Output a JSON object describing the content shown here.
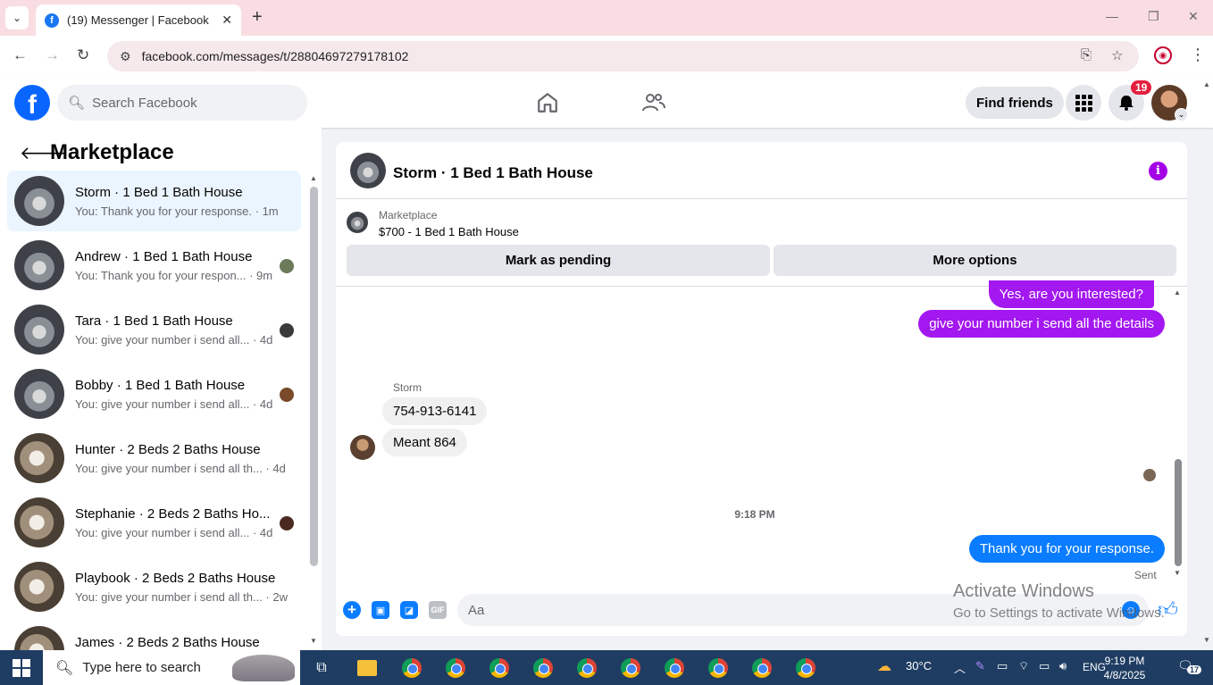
{
  "browser": {
    "tab_title": "(19) Messenger | Facebook",
    "url": "facebook.com/messages/t/28804697279178102"
  },
  "fb": {
    "search_placeholder": "Search Facebook",
    "find_friends": "Find friends",
    "notification_count": "19"
  },
  "sidebar": {
    "title": "Marketplace",
    "conversations": [
      {
        "name": "Storm · 1 Bed 1 Bath House",
        "snippet": "You: Thank you for your response. · 1m",
        "active": true
      },
      {
        "name": "Andrew · 1 Bed 1 Bath House",
        "snippet": "You: Thank you for your respon... · 9m"
      },
      {
        "name": "Tara · 1 Bed 1 Bath House",
        "snippet": "You: give your number i send all... · 4d"
      },
      {
        "name": "Bobby · 1 Bed 1 Bath House",
        "snippet": "You: give your number i send all... · 4d"
      },
      {
        "name": "Hunter · 2 Beds 2 Baths House",
        "snippet": "You: give your number i send all th... · 4d"
      },
      {
        "name": "Stephanie · 2 Beds 2 Baths Ho...",
        "snippet": "You: give your number i send all... · 4d"
      },
      {
        "name": "Playbook · 2 Beds 2 Baths House",
        "snippet": "You: give your number i send all th... · 2w"
      },
      {
        "name": "James · 2 Beds 2 Baths House",
        "snippet": ""
      }
    ]
  },
  "chat": {
    "title": "Storm · 1 Bed 1 Bath House",
    "listing_source": "Marketplace",
    "listing_price": "$700 - 1 Bed 1 Bath House",
    "mark_pending": "Mark as pending",
    "more_options": "More options",
    "messages": {
      "m1": "Yes, are you interested?",
      "m2": "give your number i send  all the details",
      "sender": "Storm",
      "m3": "754-913-6141",
      "m4": "Meant 864",
      "timestamp": "9:18 PM",
      "m5": "Thank you for your response.",
      "status": "Sent"
    },
    "composer_placeholder": "Aa",
    "gif_label": "GIF"
  },
  "watermark": {
    "line1": "Activate Windows",
    "line2": "Go to Settings to activate Windows."
  },
  "taskbar": {
    "search_placeholder": "Type here to search",
    "weather": "30°C",
    "language": "ENG",
    "time": "9:19 PM",
    "date": "4/8/2025",
    "notifications": "17"
  },
  "colors": {
    "fb_blue": "#0866ff",
    "sent_bubble": "#0a7cff",
    "purple_bubble": "#a317f0",
    "active_conv": "#ebf5ff"
  }
}
